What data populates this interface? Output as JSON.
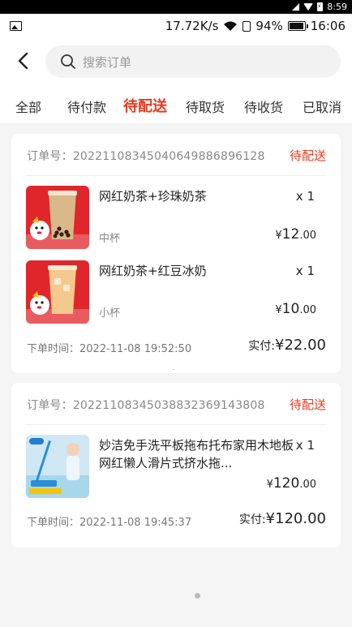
{
  "system_top": {
    "time": "8:59"
  },
  "statusbar": {
    "net_speed": "17.72K/s",
    "battery": "94%",
    "time": "16:06"
  },
  "search": {
    "placeholder": "搜索订单"
  },
  "tabs": [
    {
      "label": "全部",
      "active": false
    },
    {
      "label": "待付款",
      "active": false
    },
    {
      "label": "待配送",
      "active": true
    },
    {
      "label": "待取货",
      "active": false
    },
    {
      "label": "待收货",
      "active": false
    },
    {
      "label": "已取消",
      "active": false
    }
  ],
  "orders": [
    {
      "order_no_label": "订单号：",
      "order_no": "2022110834504064988689612‍8",
      "status": "待配送",
      "items": [
        {
          "name": "网红奶茶+珍珠奶茶",
          "qty": "x 1",
          "spec": "中杯",
          "currency": "¥",
          "price_int": "12",
          "price_dec": ".00",
          "thumb_icon": "pearl-milk-tea-image"
        },
        {
          "name": "网红奶茶+红豆冰奶",
          "qty": "x 1",
          "spec": "小杯",
          "currency": "¥",
          "price_int": "10",
          "price_dec": ".00",
          "thumb_icon": "red-bean-milk-image"
        }
      ],
      "time_label": "下单时间：",
      "time": "2022-11-08 19:52:50",
      "total_label": "实付:",
      "currency": "¥",
      "total": "22.00"
    },
    {
      "order_no_label": "订单号：",
      "order_no": "20221108345038832369143808",
      "status": "待配送",
      "items": [
        {
          "name": "妙洁免手洗平板拖布托布家用木地板网红懒人滑片式挤水拖...",
          "qty": "x 1",
          "spec": "",
          "currency": "¥",
          "price_int": "120",
          "price_dec": ".00",
          "thumb_icon": "mop-product-image"
        }
      ],
      "time_label": "下单时间：",
      "time": "2022-11-08 19:45:37",
      "total_label": "实付:",
      "currency": "¥",
      "total": "120.00"
    }
  ],
  "colors": {
    "accent": "#e53b1f",
    "background": "#f5f5f5"
  }
}
